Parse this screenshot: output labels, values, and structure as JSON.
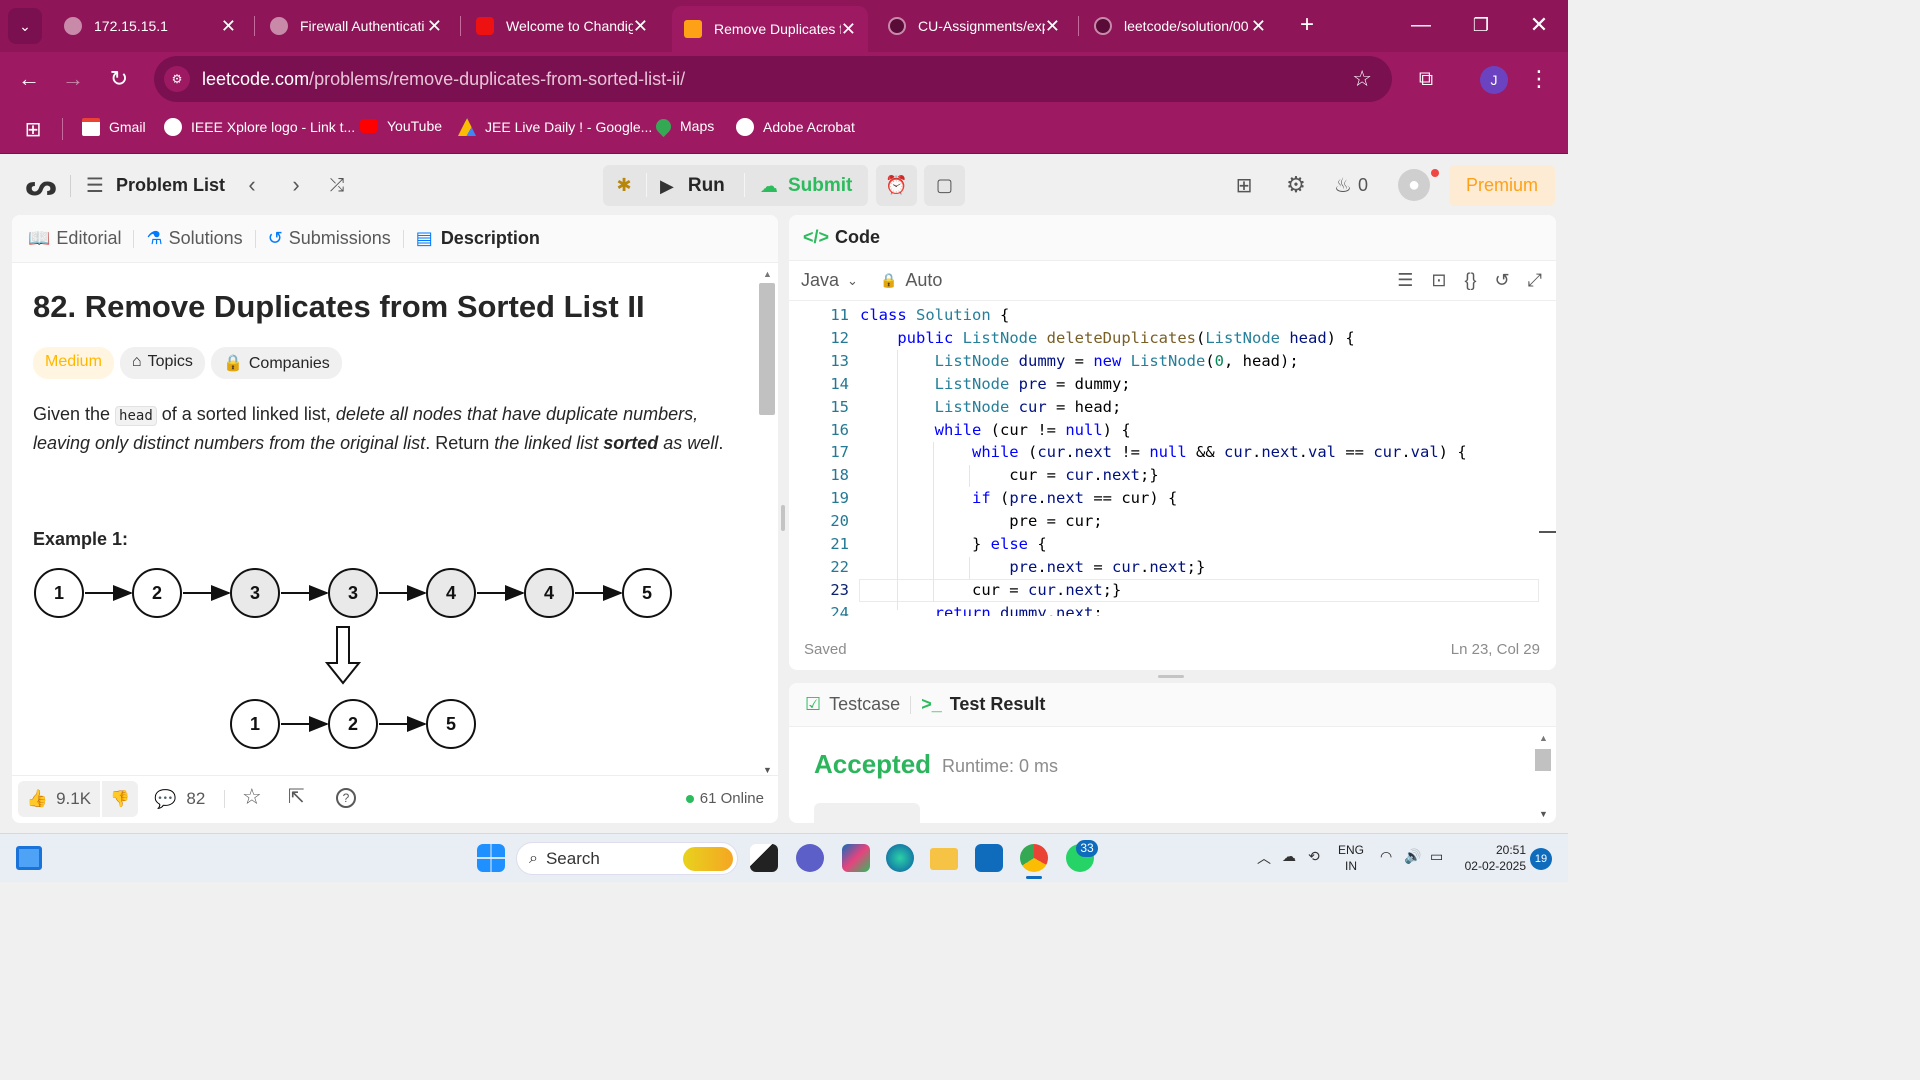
{
  "browser": {
    "tabs": [
      {
        "title": "172.15.15.1",
        "active": false
      },
      {
        "title": "Firewall Authenticati",
        "active": false
      },
      {
        "title": "Welcome to Chandig",
        "active": false
      },
      {
        "title": "Remove Duplicates f",
        "active": true
      },
      {
        "title": "CU-Assignments/exp",
        "active": false
      },
      {
        "title": "leetcode/solution/00",
        "active": false
      }
    ],
    "url_host": "leetcode.com",
    "url_path": "/problems/remove-duplicates-from-sorted-list-ii/",
    "profile_initial": "J",
    "bookmarks": [
      "Gmail",
      "IEEE Xplore logo - Link t...",
      "YouTube",
      "JEE Live Daily ! - Google...",
      "Maps",
      "Adobe Acrobat"
    ]
  },
  "lc_nav": {
    "problem_list": "Problem List",
    "run": "Run",
    "submit": "Submit",
    "streak": "0",
    "premium": "Premium"
  },
  "left_tabs": [
    "Editorial",
    "Solutions",
    "Submissions",
    "Description"
  ],
  "problem": {
    "title": "82. Remove Duplicates from Sorted List II",
    "difficulty": "Medium",
    "topics": "Topics",
    "companies": "Companies",
    "desc_1": "Given the ",
    "desc_code": "head",
    "desc_2": " of a sorted linked list, ",
    "desc_em": "delete all nodes that have duplicate numbers, leaving only distinct numbers from the original list",
    "desc_3": ". Return ",
    "desc_em2": "the linked list ",
    "desc_strong": "sorted",
    "desc_em3": " as well",
    "desc_4": ".",
    "example_title": "Example 1:",
    "input_list": [
      "1",
      "2",
      "3",
      "3",
      "4",
      "4",
      "5"
    ],
    "output_list": [
      "1",
      "2",
      "5"
    ]
  },
  "footer": {
    "likes": "9.1K",
    "comments": "82",
    "online": "61 Online"
  },
  "code_panel": {
    "title": "Code",
    "language": "Java",
    "mode": "Auto",
    "saved": "Saved",
    "cursor": "Ln 23, Col 29",
    "line_numbers": [
      "11",
      "12",
      "13",
      "14",
      "15",
      "16",
      "17",
      "18",
      "19",
      "20",
      "21",
      "22",
      "23",
      "24"
    ]
  },
  "result_panel": {
    "testcase_tab": "Testcase",
    "result_tab": "Test Result",
    "status": "Accepted",
    "runtime": "Runtime: 0 ms"
  },
  "taskbar": {
    "search": "Search",
    "whatsapp_badge": "33",
    "lang": "ENG",
    "region": "IN",
    "time": "20:51",
    "date": "02-02-2025",
    "notif": "19"
  },
  "colors": {
    "browser_frame": "#9d1a63",
    "accent_green": "#2cbb5d",
    "accepted": "#2db55d",
    "medium": "#ffb800"
  }
}
